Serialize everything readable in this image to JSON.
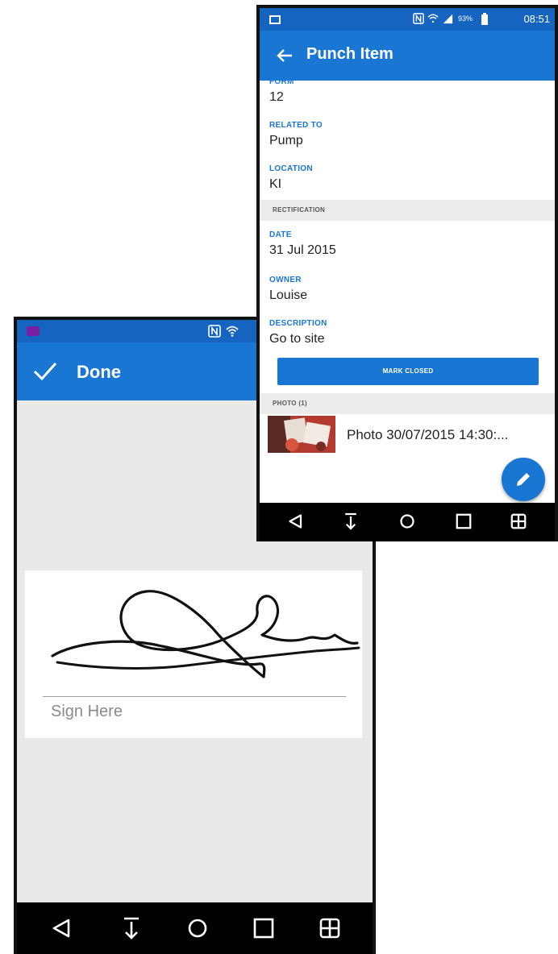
{
  "signature_screen": {
    "status_bar": {
      "icons": [
        "app-badge-icon",
        "nfc-icon",
        "wifi-icon"
      ]
    },
    "app_bar": {
      "done_label": "Done",
      "done_icon": "checkmark-icon"
    },
    "signature_pad": {
      "hint": "Sign Here"
    },
    "nav_bar": {
      "buttons": [
        "back-icon",
        "download-icon",
        "home-icon",
        "recents-icon",
        "grid-icon"
      ]
    }
  },
  "punch_item_screen": {
    "status_bar": {
      "battery_percent": "93%",
      "time": "08:51",
      "icons": [
        "image-icon",
        "nfc-icon",
        "wifi-icon",
        "signal-icon",
        "battery-icon"
      ]
    },
    "app_bar": {
      "title": "Punch Item",
      "back_icon": "arrow-left-icon"
    },
    "fields": [
      {
        "label": "FORM",
        "value": "12"
      },
      {
        "label": "RELATED TO",
        "value": "Pump"
      },
      {
        "label": "LOCATION",
        "value": "KI"
      }
    ],
    "rectification_section": "RECTIFICATION",
    "rectification_fields": [
      {
        "label": "DATE",
        "value": "31 Jul 2015"
      },
      {
        "label": "OWNER",
        "value": "Louise"
      },
      {
        "label": "DESCRIPTION",
        "value": "Go to site"
      }
    ],
    "mark_closed_label": "MARK CLOSED",
    "photo_section": "PHOTO (1)",
    "photo_item": {
      "name": "Photo 30/07/2015 14:30:..."
    },
    "fab_icon": "edit-pencil-icon",
    "nav_bar": {
      "buttons": [
        "back-icon",
        "download-icon",
        "home-icon",
        "recents-icon",
        "grid-icon"
      ]
    }
  },
  "colors": {
    "primary": "#1976D2",
    "status_bar": "#1565C0",
    "content_bg": "#e9e9e9"
  }
}
